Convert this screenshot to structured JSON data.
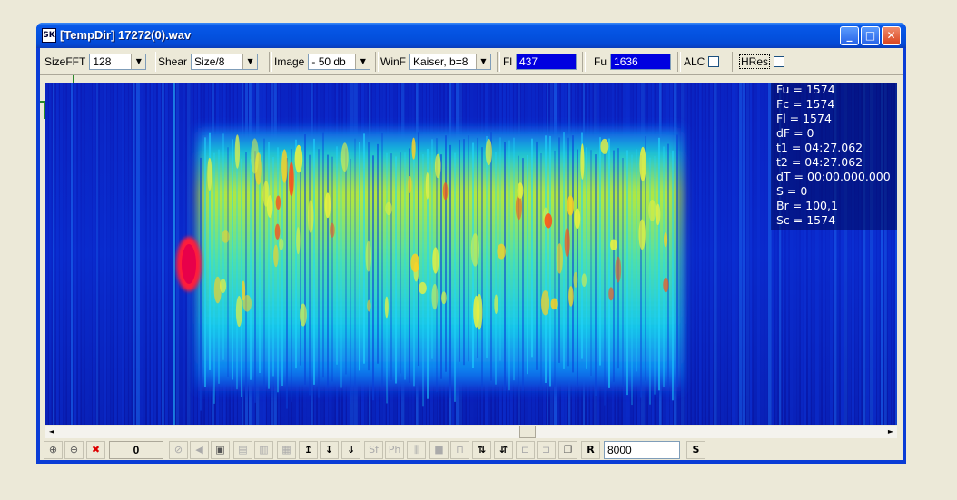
{
  "window": {
    "title": "[TempDir] 17272(0).wav",
    "app_icon_text": "SK",
    "minimize_glyph": "_",
    "maximize_glyph": "□",
    "close_glyph": "✕"
  },
  "toolbar": {
    "sizefft_label": "SizeFFT",
    "sizefft_value": "128",
    "shear_label": "Shear",
    "shear_value": "Size/8",
    "image_label": "Image",
    "image_value": "- 50 db",
    "winf_label": "WinF",
    "winf_value": "Kaiser, b=8",
    "fl_label": "Fl",
    "fl_value": "437",
    "fu_label": "Fu",
    "fu_value": "1636",
    "alc_label": "ALC",
    "alc_checked": false,
    "hres_label": "HRes",
    "hres_checked": false,
    "combo_arrow": "▼"
  },
  "overlay": {
    "lines": [
      "Fu = 1574",
      "Fc = 1574",
      "Fl = 1574",
      "dF = 0",
      "t1 = 04:27.062",
      "t2 = 04:27.062",
      "dT = 00:00.000.000",
      "S = 0",
      "Br = 100,1",
      "Sc = 1574"
    ]
  },
  "scrollbar": {
    "left_arrow": "◄",
    "right_arrow": "►",
    "position": 0.57
  },
  "bottombar": {
    "counter_value": "0",
    "rate_value": "8000",
    "r_label": "R",
    "s_label": "S",
    "icons": [
      {
        "name": "zoom-in-icon",
        "glyph": "🔍"
      },
      {
        "name": "zoom-out-icon",
        "glyph": "🔎"
      },
      {
        "name": "delete-icon",
        "glyph": "✖"
      }
    ],
    "ph_label": "Ph",
    "sf_label": "Sf"
  },
  "colors": {
    "spectro_bg": "#0a1ab8",
    "signal_hot": "#ff1a3a",
    "titlebar": "#0452e0",
    "field_blue": "#0000e0"
  }
}
